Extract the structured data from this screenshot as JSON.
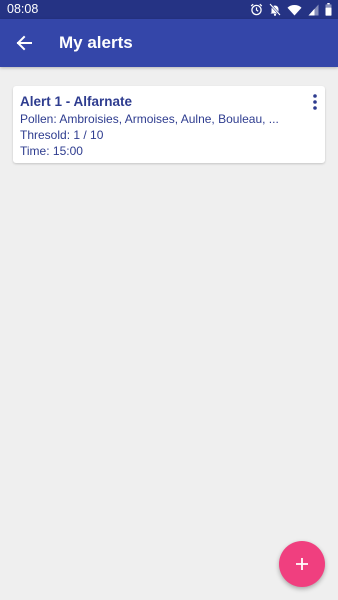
{
  "status_bar": {
    "time": "08:08",
    "icons": [
      "alarm-icon",
      "notifications-off-icon",
      "wifi-icon",
      "cellular-signal-icon",
      "battery-icon"
    ]
  },
  "app_bar": {
    "title": "My alerts",
    "back_icon": "arrow-back-icon"
  },
  "alerts": [
    {
      "title": "Alert 1 - Alfarnate",
      "pollen": "Pollen: Ambroisies, Armoises, Aulne, Bouleau, ...",
      "threshold": "Thresold: 1 / 10",
      "time": "Time: 15:00",
      "menu_icon": "more-vertical-icon"
    }
  ],
  "fab": {
    "icon": "plus-icon"
  },
  "colors": {
    "status_bar": "#253384",
    "app_bar": "#3446a9",
    "background": "#efefef",
    "card_text": "#2e3c8f",
    "fab": "#f03f7f"
  }
}
